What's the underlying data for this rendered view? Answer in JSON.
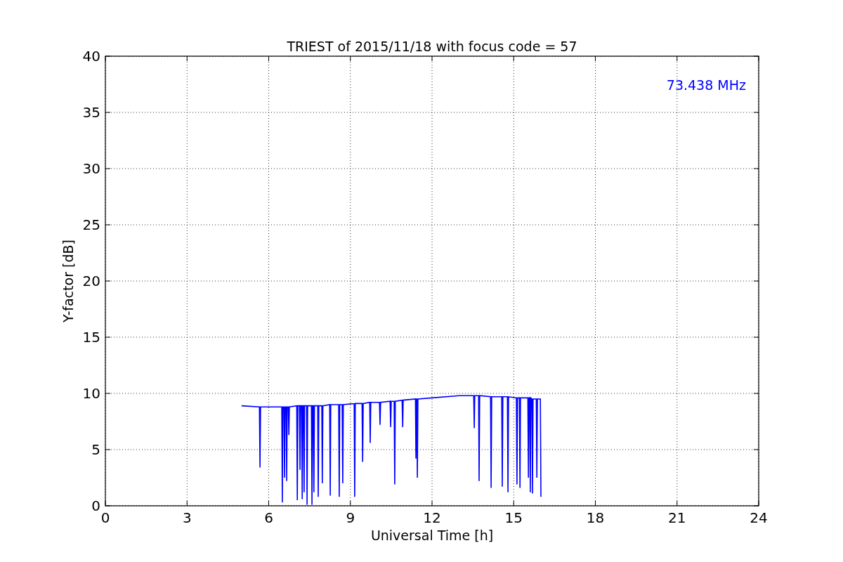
{
  "chart_data": {
    "type": "line",
    "title": "TRIEST of 2015/11/18 with focus code = 57",
    "xlabel": "Universal Time [h]",
    "ylabel": "Y-factor [dB]",
    "xlim": [
      0,
      24
    ],
    "ylim": [
      0,
      40
    ],
    "xticks": [
      0,
      3,
      6,
      9,
      12,
      15,
      18,
      21,
      24
    ],
    "yticks": [
      0,
      5,
      10,
      15,
      20,
      25,
      30,
      35,
      40
    ],
    "x": [
      5.0,
      5.66,
      5.68,
      5.7,
      6.48,
      6.5,
      6.52,
      6.56,
      6.58,
      6.6,
      6.64,
      6.66,
      6.68,
      6.72,
      6.74,
      6.76,
      7.03,
      7.05,
      7.07,
      7.13,
      7.15,
      7.17,
      7.21,
      7.23,
      7.25,
      7.28,
      7.3,
      7.32,
      7.39,
      7.41,
      7.43,
      7.57,
      7.59,
      7.61,
      7.64,
      7.66,
      7.68,
      7.8,
      7.82,
      7.84,
      7.95,
      7.97,
      7.99,
      8.24,
      8.26,
      8.28,
      8.57,
      8.59,
      8.61,
      8.7,
      8.72,
      8.74,
      9.14,
      9.16,
      9.18,
      9.43,
      9.45,
      9.47,
      9.71,
      9.73,
      9.75,
      10.07,
      10.09,
      10.11,
      10.46,
      10.48,
      10.5,
      10.61,
      10.63,
      10.65,
      10.9,
      10.92,
      10.94,
      11.39,
      11.41,
      11.43,
      11.44,
      11.46,
      11.48,
      12,
      13,
      13.53,
      13.55,
      13.57,
      13.71,
      13.73,
      13.75,
      14.15,
      14.17,
      14.19,
      14.56,
      14.58,
      14.6,
      14.77,
      14.79,
      14.81,
      15.1,
      15.12,
      15.14,
      15.21,
      15.23,
      15.25,
      15.52,
      15.54,
      15.56,
      15.59,
      15.61,
      15.63,
      15.67,
      15.69,
      15.71,
      15.83,
      15.85,
      15.87,
      15.98,
      16.0
    ],
    "series": [
      {
        "name": "73.438 MHz",
        "color": "#0000ff",
        "values": [
          8.9,
          8.8,
          3.4,
          8.8,
          8.8,
          0.3,
          8.8,
          8.8,
          2.5,
          8.8,
          8.8,
          2.2,
          8.8,
          8.8,
          6.3,
          8.8,
          8.9,
          0.5,
          8.9,
          8.9,
          3.2,
          8.9,
          8.9,
          0.6,
          8.9,
          8.9,
          1.2,
          8.9,
          8.9,
          0.1,
          8.9,
          8.9,
          0.1,
          8.9,
          8.9,
          1.2,
          8.9,
          8.9,
          0.8,
          8.9,
          8.9,
          2.0,
          8.9,
          9.0,
          0.9,
          9.0,
          9.0,
          0.8,
          9.0,
          9.0,
          2.0,
          9.0,
          9.1,
          0.8,
          9.1,
          9.1,
          3.9,
          9.1,
          9.2,
          5.6,
          9.2,
          9.2,
          7.2,
          9.2,
          9.3,
          7.0,
          9.3,
          9.3,
          1.9,
          9.3,
          9.4,
          7.0,
          9.4,
          9.5,
          4.2,
          9.5,
          9.5,
          2.5,
          9.5,
          9.6,
          9.8,
          9.8,
          6.9,
          9.8,
          9.8,
          2.2,
          9.8,
          9.7,
          1.6,
          9.7,
          9.7,
          1.7,
          9.7,
          9.7,
          1.2,
          9.7,
          9.6,
          1.9,
          9.6,
          9.6,
          1.6,
          9.6,
          9.6,
          2.5,
          9.6,
          9.6,
          1.2,
          9.6,
          9.5,
          1.1,
          9.5,
          9.5,
          2.5,
          9.5,
          9.5,
          0.8
        ]
      }
    ],
    "grid": true
  }
}
